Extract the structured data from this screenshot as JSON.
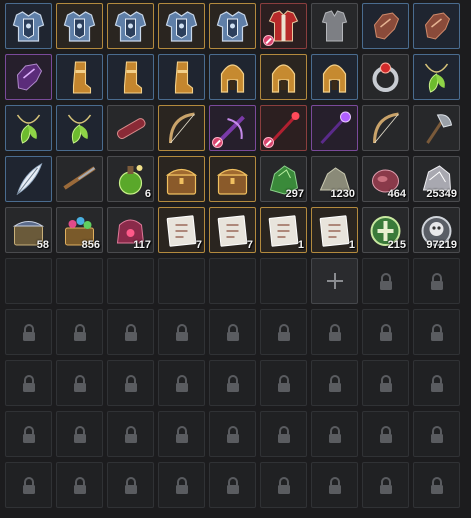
{
  "inventory": {
    "slots": [
      {
        "icon": "chest-armor-steel-icon",
        "quality": "blue",
        "count": ""
      },
      {
        "icon": "chest-armor-steel-icon",
        "quality": "gold",
        "count": ""
      },
      {
        "icon": "chest-armor-steel-icon",
        "quality": "gold",
        "count": ""
      },
      {
        "icon": "chest-armor-steel-icon",
        "quality": "gold",
        "count": ""
      },
      {
        "icon": "chest-armor-steel-icon",
        "quality": "gold",
        "count": ""
      },
      {
        "icon": "red-tunic-icon",
        "quality": "red",
        "count": "",
        "restricted": true
      },
      {
        "icon": "plain-vest-icon",
        "quality": "gray",
        "count": ""
      },
      {
        "icon": "leather-gloves-icon",
        "quality": "blue",
        "count": ""
      },
      {
        "icon": "leather-gloves-icon",
        "quality": "blue",
        "count": ""
      },
      {
        "icon": "purple-gloves-icon",
        "quality": "purple",
        "count": ""
      },
      {
        "icon": "golden-boots-icon",
        "quality": "blue",
        "count": ""
      },
      {
        "icon": "golden-boots-icon",
        "quality": "blue",
        "count": ""
      },
      {
        "icon": "golden-boots-icon",
        "quality": "blue",
        "count": ""
      },
      {
        "icon": "golden-helmet-icon",
        "quality": "blue",
        "count": ""
      },
      {
        "icon": "golden-helmet-icon",
        "quality": "gold",
        "count": ""
      },
      {
        "icon": "golden-helmet-icon",
        "quality": "blue",
        "count": ""
      },
      {
        "icon": "ruby-ring-icon",
        "quality": "gray",
        "count": ""
      },
      {
        "icon": "green-leaf-necklace-icon",
        "quality": "blue",
        "count": ""
      },
      {
        "icon": "green-leaf-necklace-icon",
        "quality": "blue",
        "count": ""
      },
      {
        "icon": "green-leaf-necklace-icon",
        "quality": "blue",
        "count": ""
      },
      {
        "icon": "scroll-case-icon",
        "quality": "gray",
        "count": ""
      },
      {
        "icon": "longbow-icon",
        "quality": "gold",
        "count": ""
      },
      {
        "icon": "purple-crossbow-icon",
        "quality": "purple",
        "count": "",
        "restricted": true
      },
      {
        "icon": "crimson-staff-icon",
        "quality": "red",
        "count": "",
        "restricted": true
      },
      {
        "icon": "purple-staff-icon",
        "quality": "purple",
        "count": ""
      },
      {
        "icon": "longbow-icon",
        "quality": "gray",
        "count": ""
      },
      {
        "icon": "battle-axe-icon",
        "quality": "gray",
        "count": ""
      },
      {
        "icon": "feather-icon",
        "quality": "blue",
        "count": ""
      },
      {
        "icon": "musket-icon",
        "quality": "gray",
        "count": ""
      },
      {
        "icon": "green-potion-icon",
        "quality": "gray",
        "count": "6"
      },
      {
        "icon": "treasure-chest-icon",
        "quality": "gold",
        "count": ""
      },
      {
        "icon": "treasure-chest-icon",
        "quality": "gold",
        "count": ""
      },
      {
        "icon": "green-ore-icon",
        "quality": "gray",
        "count": "297"
      },
      {
        "icon": "stone-ore-icon",
        "quality": "gray",
        "count": "1230"
      },
      {
        "icon": "raw-meat-icon",
        "quality": "gray",
        "count": "464"
      },
      {
        "icon": "silver-ore-icon",
        "quality": "gray",
        "count": "25349"
      },
      {
        "icon": "silver-chest-icon",
        "quality": "gray",
        "count": "58"
      },
      {
        "icon": "gem-chest-icon",
        "quality": "gray",
        "count": "856"
      },
      {
        "icon": "red-gem-pouch-icon",
        "quality": "gray",
        "count": "117"
      },
      {
        "icon": "paper-scroll-icon",
        "quality": "gold",
        "count": "7"
      },
      {
        "icon": "paper-scroll-icon",
        "quality": "gold",
        "count": "7"
      },
      {
        "icon": "paper-scroll-icon",
        "quality": "gold",
        "count": "1"
      },
      {
        "icon": "paper-scroll-icon",
        "quality": "gold",
        "count": "1"
      },
      {
        "icon": "green-emblem-coin-icon",
        "quality": "gray",
        "count": "215"
      },
      {
        "icon": "skull-coin-icon",
        "quality": "gray",
        "count": "97219"
      },
      {
        "state": "empty"
      },
      {
        "state": "empty"
      },
      {
        "state": "empty"
      },
      {
        "state": "empty"
      },
      {
        "state": "empty"
      },
      {
        "state": "empty"
      },
      {
        "state": "add"
      },
      {
        "state": "locked"
      },
      {
        "state": "locked"
      },
      {
        "state": "locked"
      },
      {
        "state": "locked"
      },
      {
        "state": "locked"
      },
      {
        "state": "locked"
      },
      {
        "state": "locked"
      },
      {
        "state": "locked"
      },
      {
        "state": "locked"
      },
      {
        "state": "locked"
      },
      {
        "state": "locked"
      },
      {
        "state": "locked"
      },
      {
        "state": "locked"
      },
      {
        "state": "locked"
      },
      {
        "state": "locked"
      },
      {
        "state": "locked"
      },
      {
        "state": "locked"
      },
      {
        "state": "locked"
      },
      {
        "state": "locked"
      },
      {
        "state": "locked"
      },
      {
        "state": "locked"
      },
      {
        "state": "locked"
      },
      {
        "state": "locked"
      },
      {
        "state": "locked"
      },
      {
        "state": "locked"
      },
      {
        "state": "locked"
      },
      {
        "state": "locked"
      },
      {
        "state": "locked"
      },
      {
        "state": "locked"
      },
      {
        "state": "locked"
      },
      {
        "state": "locked"
      },
      {
        "state": "locked"
      },
      {
        "state": "locked"
      },
      {
        "state": "locked"
      },
      {
        "state": "locked"
      },
      {
        "state": "locked"
      },
      {
        "state": "locked"
      },
      {
        "state": "locked"
      }
    ]
  }
}
